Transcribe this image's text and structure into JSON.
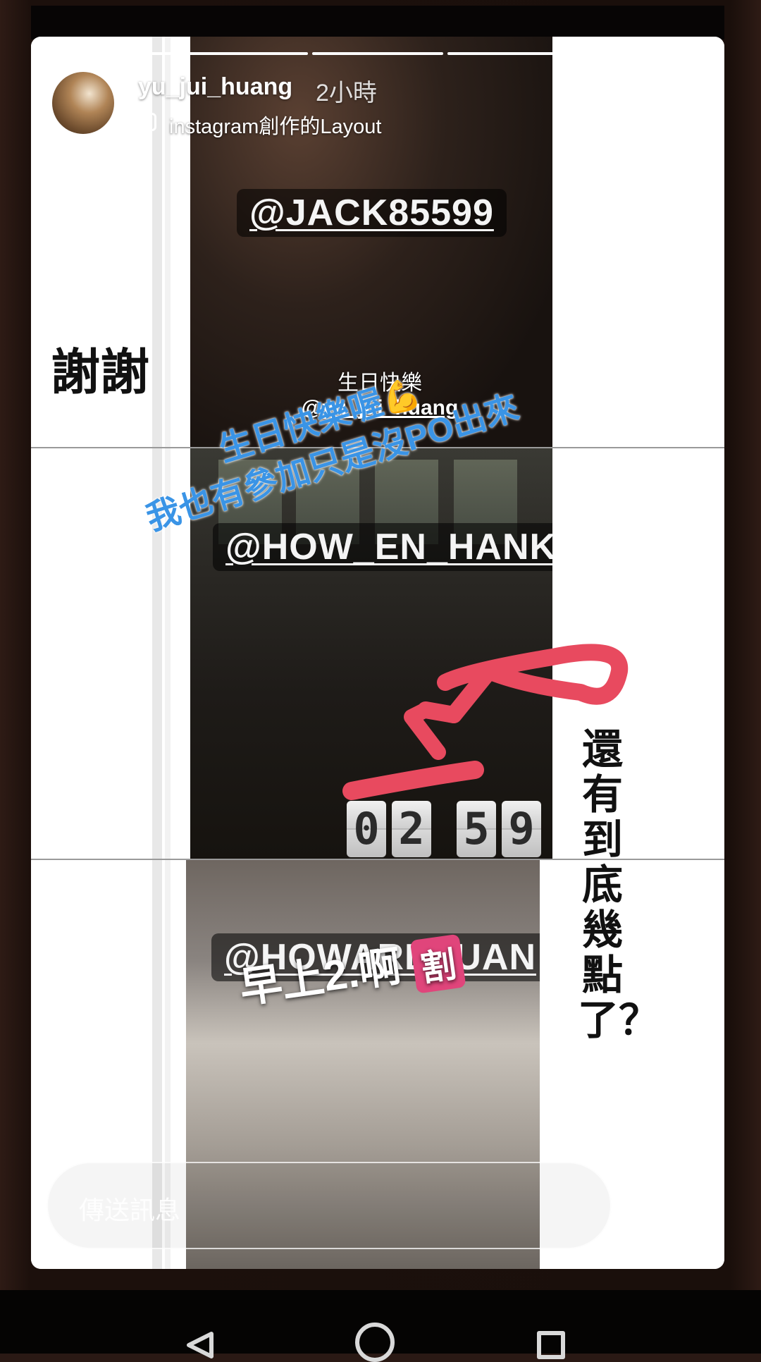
{
  "story": {
    "username": "yu_jui_huang",
    "time_ago": "2小時",
    "layout_label": "instagram創作的Layout",
    "progress": {
      "total_segments": 5,
      "completed": 5
    }
  },
  "panels": {
    "top": {
      "mention": "@JACK85599",
      "side_text": "謝謝",
      "birthday_line": "生日快樂",
      "birthday_handle": "@yu_jui_huang"
    },
    "middle": {
      "blue_line1": "生日快樂喔",
      "blue_line2": "我也有參加只是沒PO出來",
      "mention": "@HOW_EN_HANK",
      "counter_digits": [
        "0",
        "2",
        "5",
        "9"
      ]
    },
    "bottom": {
      "morning_text": "早上2.啊",
      "badge_text": "割",
      "mention": "@HOWARDTUAN",
      "vertical_text": "還有到底幾點了？"
    }
  },
  "reply": {
    "placeholder": "傳送訊息"
  },
  "colors": {
    "blue_text": "#3a94e6",
    "arrow_red": "#e84a5f",
    "badge_pink": "#e0457b"
  }
}
